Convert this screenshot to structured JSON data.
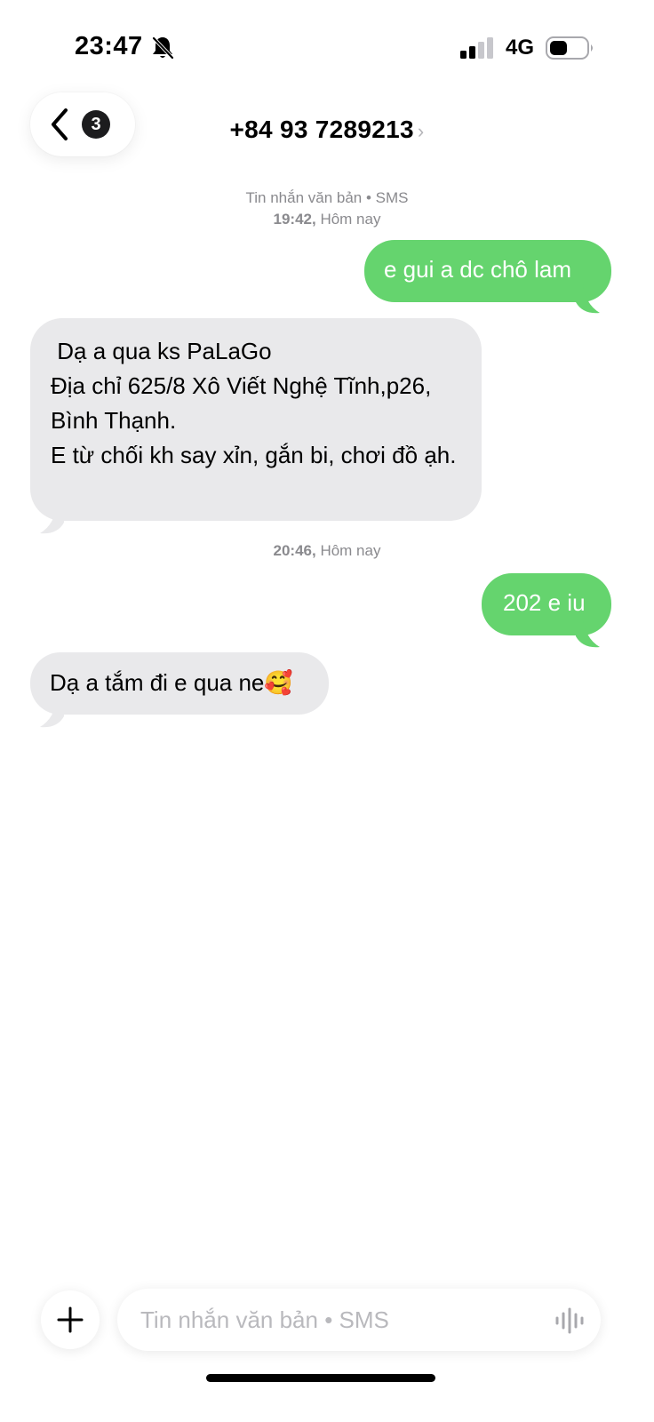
{
  "status_bar": {
    "time": "23:47",
    "network": "4G"
  },
  "header": {
    "unread_count": "3",
    "contact": "+84 93 7289213",
    "chevron": "›"
  },
  "conversation": {
    "meta1": {
      "service": "Tin nhắn văn bản • SMS",
      "time_bold": "19:42,",
      "day": " Hôm nay"
    },
    "meta2": {
      "time_bold": "20:46,",
      "day": " Hôm nay"
    },
    "messages": [
      {
        "direction": "outgoing",
        "text": "e gui a dc chô lam"
      },
      {
        "direction": "incoming",
        "text": " Dạ a qua ks PaLaGo\nĐịa chỉ 625/8 Xô Viết Nghệ Tĩnh,p26, Bình Thạnh.\nE từ chối kh say xỉn, gắn bi, chơi đồ ạh."
      },
      {
        "direction": "outgoing",
        "text": "202 e iu"
      },
      {
        "direction": "incoming",
        "text": "Dạ a tắm đi e qua ne🥰"
      }
    ]
  },
  "composer": {
    "placeholder": "Tin nhắn văn bản • SMS"
  },
  "colors": {
    "outgoing_bubble": "#65d46e",
    "incoming_bubble": "#e9e9eb",
    "meta_text": "#8a8a8e"
  },
  "icons": [
    "bell-off-icon",
    "signal-icon",
    "battery-icon",
    "back-chevron-icon",
    "plus-icon",
    "waveform-icon"
  ]
}
